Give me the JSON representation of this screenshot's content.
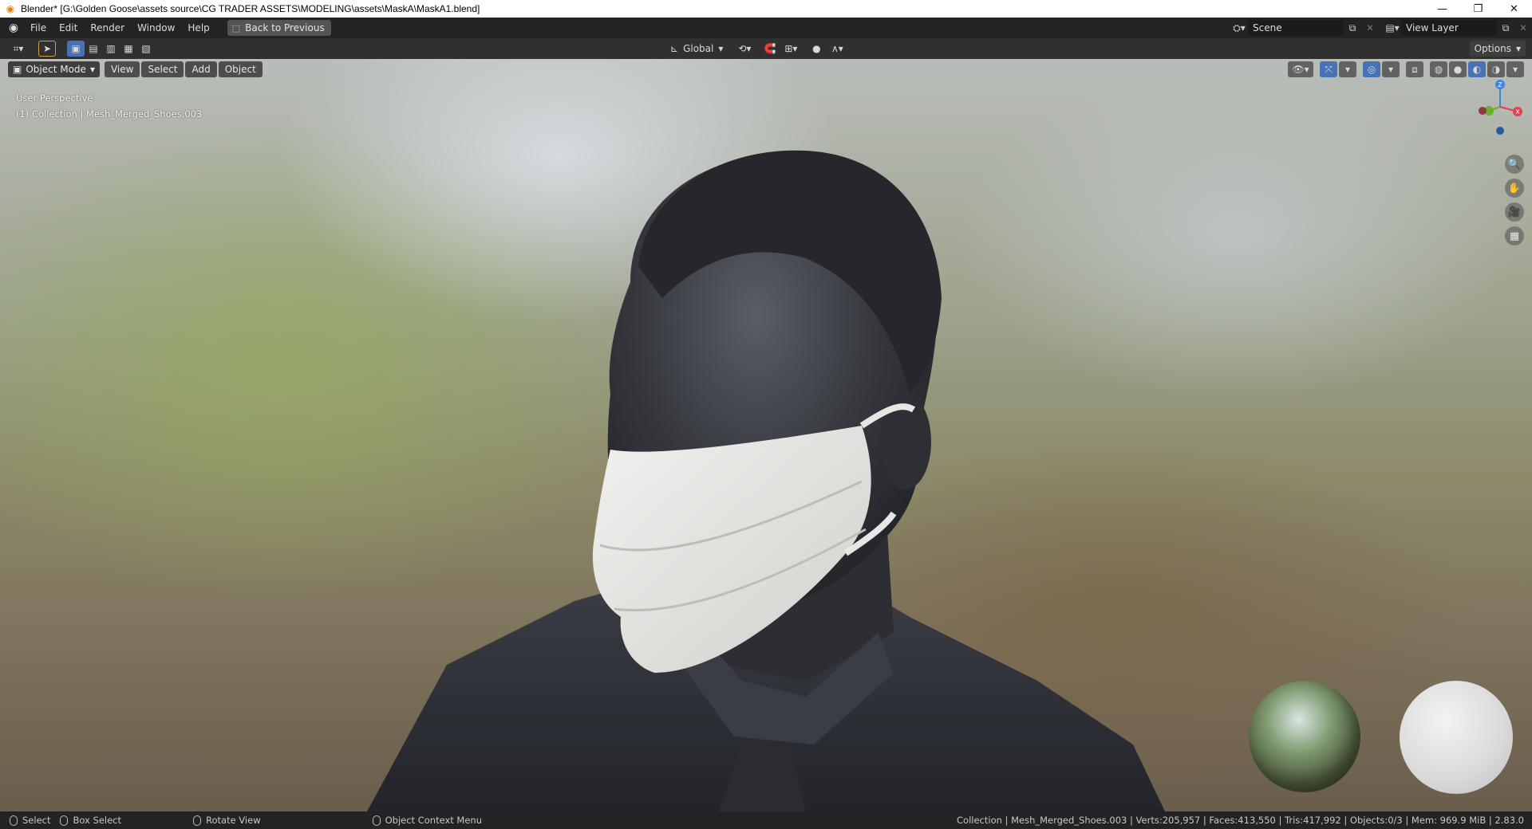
{
  "window": {
    "title": "Blender* [G:\\Golden Goose\\assets source\\CG TRADER ASSETS\\MODELING\\assets\\MaskA\\MaskA1.blend]",
    "controls": [
      "minimize",
      "restore",
      "close"
    ]
  },
  "menubar": {
    "items": [
      "File",
      "Edit",
      "Render",
      "Window",
      "Help"
    ],
    "back_button": "Back to Previous",
    "scene": "Scene",
    "view_layer": "View Layer"
  },
  "toolbar": {
    "transform_orientation": "Global",
    "options_label": "Options"
  },
  "viewport": {
    "mode": "Object Mode",
    "menus": [
      "View",
      "Select",
      "Add",
      "Object"
    ],
    "perspective_label": "User Perspective",
    "collection_label": "(1) Collection | Mesh_Merged_Shoes.003",
    "gizmo_axes": {
      "z": "Z",
      "x": "X"
    },
    "colors": {
      "x_axis": "#e04050",
      "y_axis": "#6ab12d",
      "z_axis": "#3d86e0",
      "accent": "#4772b3"
    }
  },
  "statusbar": {
    "select": "Select",
    "box_select": "Box Select",
    "rotate_view": "Rotate View",
    "context_menu": "Object Context Menu",
    "stats": "Collection | Mesh_Merged_Shoes.003 | Verts:205,957 | Faces:413,550 | Tris:417,992 | Objects:0/3 | Mem: 969.9 MiB | 2.83.0"
  }
}
